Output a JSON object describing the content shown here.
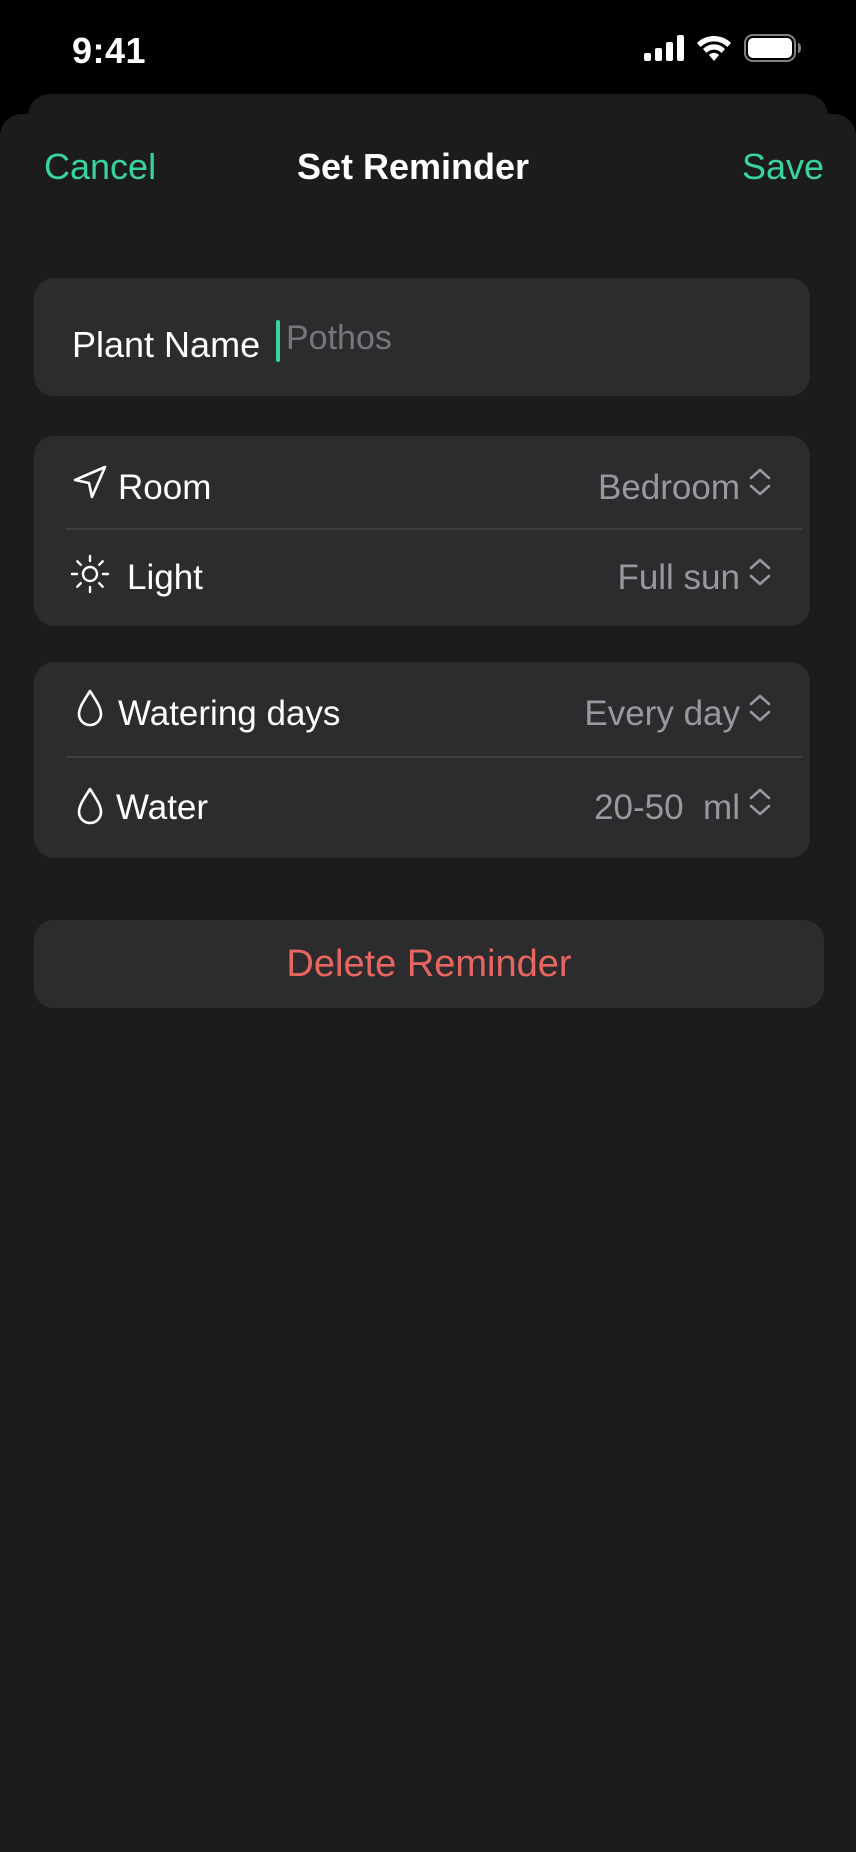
{
  "status_bar": {
    "time": "9:41",
    "icons": [
      "cellular-signal-icon",
      "wifi-icon",
      "battery-icon"
    ]
  },
  "nav": {
    "cancel_label": "Cancel",
    "title": "Set Reminder",
    "save_label": "Save"
  },
  "plant": {
    "name_label": "Plant Name",
    "name_placeholder": "Pothos",
    "name_value": ""
  },
  "location": {
    "room": {
      "icon": "location-arrow-icon",
      "label": "Room",
      "value": "Bedroom"
    },
    "light": {
      "icon": "sun-icon",
      "label": "Light",
      "value": "Full sun"
    }
  },
  "watering": {
    "days": {
      "icon": "water-drop-icon",
      "label": "Watering days",
      "value": "Every day"
    },
    "water": {
      "icon": "water-drop-icon",
      "label": "Water",
      "value": "20-50  ml"
    }
  },
  "delete_label": "Delete Reminder",
  "colors": {
    "accent": "#38d39f",
    "destructive": "#e8665f",
    "background": "#1c1c1e",
    "card": "#2c2c2e",
    "secondary_text": "#98989d"
  }
}
